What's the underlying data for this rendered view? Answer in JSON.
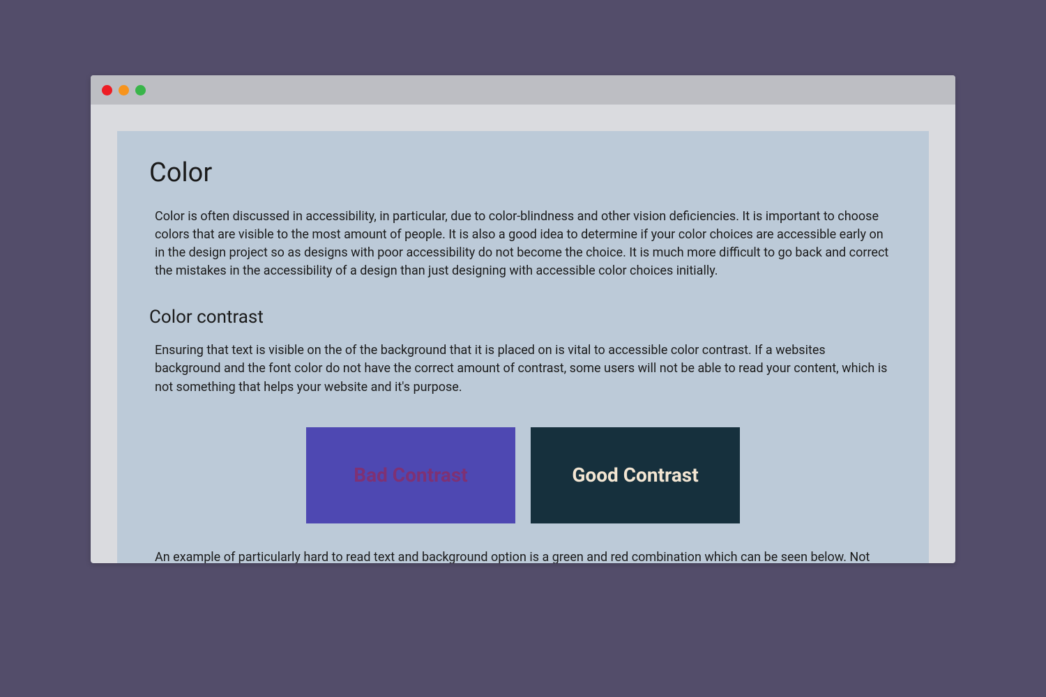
{
  "article": {
    "heading": "Color",
    "intro": "Color is often discussed in accessibility, in particular, due to color-blindness and other vision deficiencies. It is important to choose colors that are visible to the most amount of people. It is also a good idea to determine if your color choices are accessible early on in the design project so as designs with poor accessibility do not become the choice. It is much more difficult to go back and correct the mistakes in the accessibility of a design than just designing with accessible color choices initially.",
    "section": {
      "heading": "Color contrast",
      "body": "Ensuring that text is visible on the of the background that it is placed on is vital to accessible color contrast. If a websites background and the font color do not have the correct amount of contrast, some users will not be able to read your content, which is not something that helps your website and it's purpose.",
      "examples": {
        "bad_label": "Bad Contrast",
        "good_label": "Good Contrast"
      },
      "followup": "An example of particularly hard to read text and background option is a green and red combination which can be seen below. Not only is this difficult or impossible for certain colorblind individuals to see, even those without vision problems can have difficulty reading this."
    }
  },
  "colors": {
    "page_bg": "#534d6a",
    "window_bg": "#dadbdf",
    "titlebar_bg": "#bdbec3",
    "content_bg": "#bccad8",
    "bad_bg": "#4e48b2",
    "bad_fg": "#7e3174",
    "good_bg": "#16303d",
    "good_fg": "#f3e6d3"
  }
}
